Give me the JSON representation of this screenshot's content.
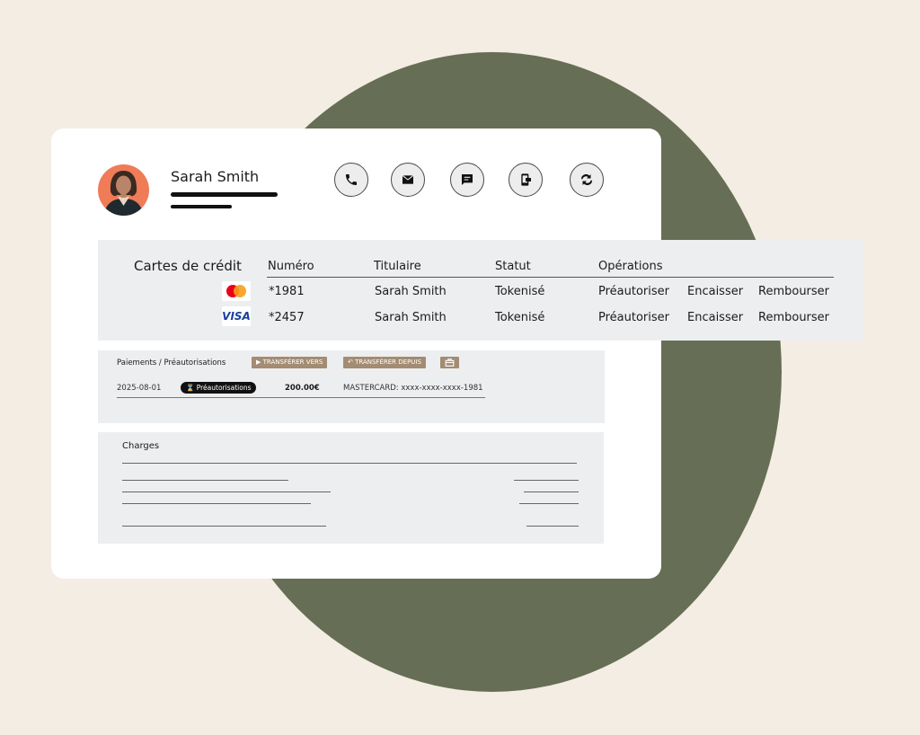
{
  "profile": {
    "name": "Sarah Smith"
  },
  "contact_actions": [
    "phone",
    "email",
    "chat",
    "mobile-transfer",
    "sync"
  ],
  "credit_cards": {
    "title": "Cartes de crédit",
    "columns": [
      "Numéro",
      "Titulaire",
      "Statut",
      "Opérations"
    ],
    "rows": [
      {
        "brand": "mastercard",
        "number": "*1981",
        "holder": "Sarah Smith",
        "status": "Tokenisé",
        "ops": [
          "Préautoriser",
          "Encaisser",
          "Rembourser"
        ]
      },
      {
        "brand": "VISA",
        "number": "*2457",
        "holder": "Sarah Smith",
        "status": "Tokenisé",
        "ops": [
          "Préautoriser",
          "Encaisser",
          "Rembourser"
        ]
      }
    ]
  },
  "payments": {
    "title": "Paiements / Préautorisations",
    "transfer_to": "TRANSFÉRER VERS",
    "transfer_from": "TRANSFÉRER DEPUIS",
    "row": {
      "date": "2025-08-01",
      "type": "Préautorisations",
      "amount": "200.00€",
      "card": "MASTERCARD: xxxx-xxxx-xxxx-1981"
    }
  },
  "charges": {
    "title": "Charges"
  },
  "colors": {
    "background": "#f4ede3",
    "circle": "#666f55",
    "tag": "#a38c72",
    "avatar": "#ef7c57"
  }
}
